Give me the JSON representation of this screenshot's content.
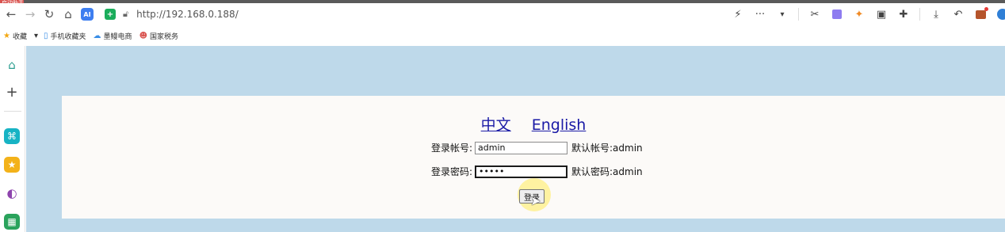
{
  "corner_badge": "启动助手",
  "browser": {
    "url": "http://192.168.0.188/",
    "ai_label": "AI",
    "shield_label": "+",
    "nav_icons": [
      "back-arrow-icon",
      "forward-arrow-icon",
      "reload-icon",
      "home-icon"
    ],
    "toolbar_icons": [
      "lightning-icon",
      "more-icon",
      "scissors-icon",
      "extension-purple-icon",
      "extension-fox-icon",
      "sidebar-icon",
      "puzzle-icon",
      "download-icon",
      "undo-icon",
      "toolbox-icon",
      "edge-icon"
    ]
  },
  "bookmarks": [
    {
      "icon": "★",
      "label": "收藏",
      "color": "#f3a712"
    },
    {
      "icon": "▾",
      "label": "",
      "color": "#555"
    },
    {
      "icon": "▯",
      "label": "手机收藏夹",
      "color": "#3a8ee6"
    },
    {
      "icon": "☁",
      "label": "墨鳗电商",
      "color": "#3a8ee6"
    },
    {
      "icon": "☻",
      "label": "国家税务",
      "color": "#d9534f"
    }
  ],
  "sidebar": [
    {
      "name": "sidebar-home-icon",
      "glyph": "⌂",
      "bg": "transparent",
      "fg": "#2a9d8f"
    },
    {
      "name": "sidebar-add-icon",
      "glyph": "+",
      "bg": "transparent",
      "fg": "#444"
    },
    {
      "name": "sidebar-app-teal-icon",
      "glyph": "⌘",
      "bg": "#17b3c4",
      "fg": "#fff"
    },
    {
      "name": "sidebar-star-icon",
      "glyph": "★",
      "bg": "#f3b21a",
      "fg": "#fff"
    },
    {
      "name": "sidebar-ai-icon",
      "glyph": "◐",
      "bg": "transparent",
      "fg": "#8e44ad"
    },
    {
      "name": "sidebar-image-icon",
      "glyph": "▦",
      "bg": "#2aa35c",
      "fg": "#fff"
    }
  ],
  "login": {
    "lang_zh": "中文",
    "lang_en": "English",
    "account_label": "登录帐号:",
    "account_value": "admin",
    "account_hint": "默认帐号:admin",
    "password_label": "登录密码:",
    "password_value": "•••••",
    "password_hint": "默认密码:admin",
    "submit_label": "登录"
  },
  "colors": {
    "page_bg": "#bed9ea",
    "panel_bg": "#fcfaf8",
    "link": "#1a1aa6"
  }
}
